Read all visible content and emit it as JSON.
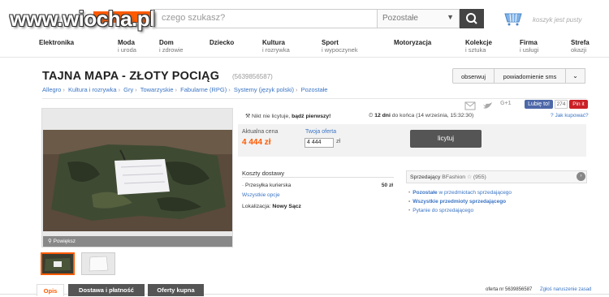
{
  "header": {
    "logo_text": "www.wiocha.pl",
    "search_placeholder": "czego szukasz?",
    "category_select": "Pozostałe",
    "basket_text": "koszyk jest pusty"
  },
  "nav": [
    {
      "title": "Elektronika",
      "sub": ""
    },
    {
      "title": "Moda",
      "sub": "i uroda"
    },
    {
      "title": "Dom",
      "sub": "i zdrowie"
    },
    {
      "title": "Dziecko",
      "sub": ""
    },
    {
      "title": "Kultura",
      "sub": "i rozrywka"
    },
    {
      "title": "Sport",
      "sub": "i wypoczynek"
    },
    {
      "title": "Motoryzacja",
      "sub": ""
    },
    {
      "title": "Kolekcje",
      "sub": "i sztuka"
    },
    {
      "title": "Firma",
      "sub": "i usługi"
    },
    {
      "title": "Strefa",
      "sub": "okazji"
    }
  ],
  "item": {
    "title": "TAJNA MAPA - ZŁOTY POCIĄG",
    "id_label": "(5639856587)",
    "watch_label": "obserwuj",
    "sms_label": "powiadomienie sms",
    "breadcrumbs": [
      "Allegro",
      "Kultura i rozrywka",
      "Gry",
      "Towarzyskie",
      "Fabularne (RPG)",
      "Systemy (język polski)",
      "Pozostałe"
    ],
    "zoom_label": "Powiększ"
  },
  "social": {
    "lubie": "Lubię to!",
    "count": "274",
    "pin": "Pin it"
  },
  "bidding": {
    "nobid_prefix": "Nikt nie licytuje,",
    "nobid_bold": "bądź pierwszy!",
    "days": "12 dni",
    "timer_rest": "do końca (14 września, 15:32:30)",
    "jak_kupowac": "Jak kupować?",
    "price_label": "Aktualna cena",
    "price": "4 444 zł",
    "offer_label": "Twoja oferta",
    "offer_value": "4 444",
    "offer_unit": "zł",
    "bid_button": "licytuj"
  },
  "shipping": {
    "title": "Koszty dostawy",
    "method": "Przesyłka kurierska",
    "cost": "50 zł",
    "all_options": "Wszystkie opcje",
    "location_label": "Lokalizacja:",
    "location": "Nowy Sącz"
  },
  "seller": {
    "label": "Sprzedający",
    "name": "BFashion",
    "rating": "(955)",
    "link1_prefix": "Pozostałe",
    "link1_rest": "w przedmiotach sprzedającego",
    "link2": "Wszystkie przedmioty sprzedającego",
    "link3": "Pytanie do sprzedającego"
  },
  "tabs": {
    "opis": "Opis",
    "dostawa": "Dostawa i płatność",
    "oferty": "Oferty kupna"
  },
  "footer": {
    "oferta_nr": "oferta nr 5639856587",
    "zglos": "Zgłoś naruszenie zasad"
  },
  "colors": {
    "accent": "#ff5a00",
    "link": "#3a74c4",
    "dark_button": "#555555"
  }
}
